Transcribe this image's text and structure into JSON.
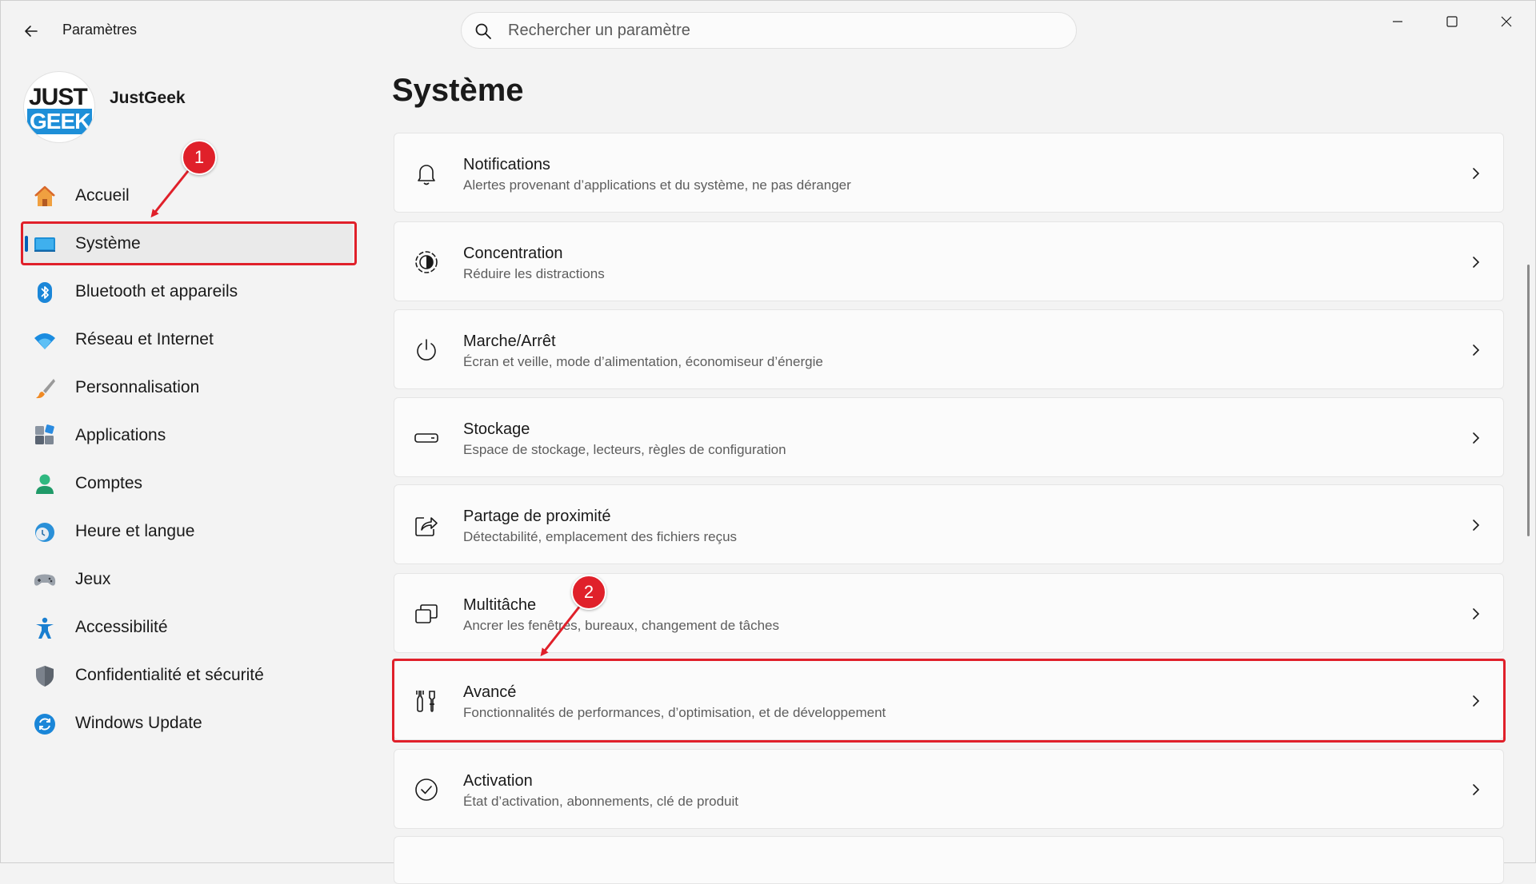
{
  "window": {
    "title": "Paramètres",
    "search_placeholder": "Rechercher un paramètre"
  },
  "profile": {
    "logo_line1": "JUST",
    "logo_line2": "GEEK",
    "name": "JustGeek"
  },
  "sidebar": {
    "items": [
      {
        "label": "Accueil",
        "icon": "home-icon"
      },
      {
        "label": "Système",
        "icon": "monitor-icon",
        "selected": true
      },
      {
        "label": "Bluetooth et appareils",
        "icon": "bluetooth-icon"
      },
      {
        "label": "Réseau et Internet",
        "icon": "wifi-icon"
      },
      {
        "label": "Personnalisation",
        "icon": "brush-icon"
      },
      {
        "label": "Applications",
        "icon": "apps-icon"
      },
      {
        "label": "Comptes",
        "icon": "person-icon"
      },
      {
        "label": "Heure et langue",
        "icon": "clock-globe-icon"
      },
      {
        "label": "Jeux",
        "icon": "gamepad-icon"
      },
      {
        "label": "Accessibilité",
        "icon": "accessibility-icon"
      },
      {
        "label": "Confidentialité et sécurité",
        "icon": "shield-icon"
      },
      {
        "label": "Windows Update",
        "icon": "update-icon"
      }
    ]
  },
  "main": {
    "title": "Système",
    "cards": [
      {
        "title": "Notifications",
        "desc": "Alertes provenant d’applications et du système, ne pas déranger",
        "icon": "bell-icon"
      },
      {
        "title": "Concentration",
        "desc": "Réduire les distractions",
        "icon": "focus-icon"
      },
      {
        "title": "Marche/Arrêt",
        "desc": "Écran et veille, mode d’alimentation, économiseur d’énergie",
        "icon": "power-icon"
      },
      {
        "title": "Stockage",
        "desc": "Espace de stockage, lecteurs, règles de configuration",
        "icon": "storage-icon"
      },
      {
        "title": "Partage de proximité",
        "desc": "Détectabilité, emplacement des fichiers reçus",
        "icon": "share-icon"
      },
      {
        "title": "Multitâche",
        "desc": "Ancrer les fenêtres, bureaux, changement de tâches",
        "icon": "multitask-icon"
      },
      {
        "title": "Avancé",
        "desc": "Fonctionnalités de performances, d’optimisation, et de développement",
        "icon": "tools-icon"
      },
      {
        "title": "Activation",
        "desc": "État d’activation, abonnements, clé de produit",
        "icon": "checkmark-circle-icon"
      }
    ]
  },
  "annotations": {
    "badge_1": "1",
    "badge_2": "2",
    "color": "#e0202a"
  },
  "colors": {
    "accent": "#005fb8",
    "background": "#f3f3f3",
    "card": "#fbfbfb"
  }
}
